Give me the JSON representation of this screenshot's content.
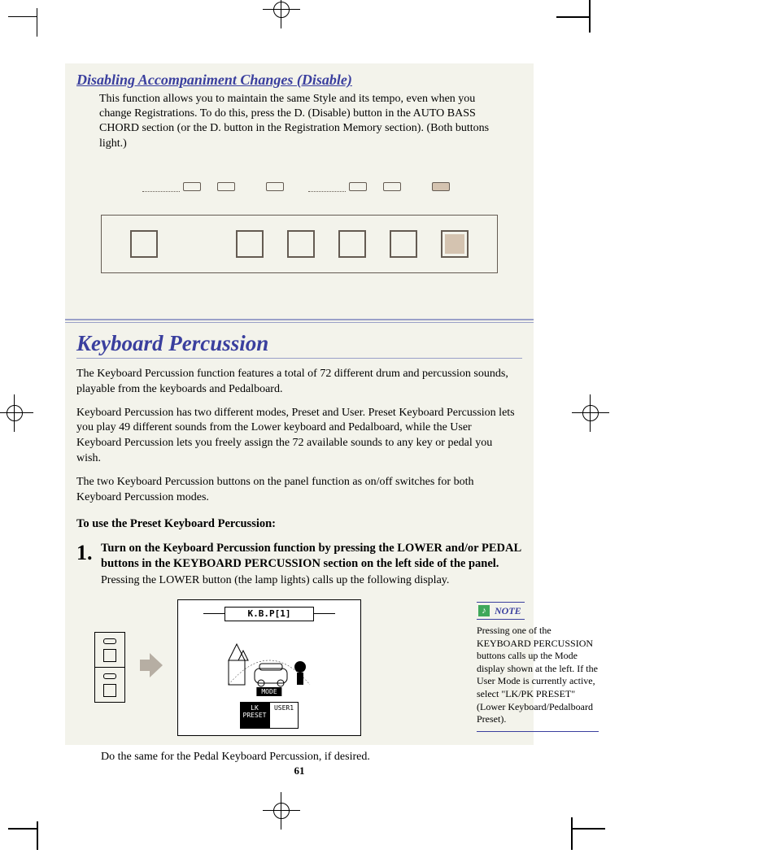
{
  "section1": {
    "title": "Disabling Accompaniment Changes (Disable)",
    "body": "This function allows you to maintain the same Style and its tempo, even when you change Registrations.  To do this, press the D. (Disable) button in the AUTO BASS CHORD section (or the D. button in the Registration Memory section).  (Both buttons light.)"
  },
  "section2": {
    "title": "Keyboard Percussion",
    "p1": "The Keyboard Percussion function features a total of 72 different drum and percussion sounds, playable from the keyboards and Pedalboard.",
    "p2": "Keyboard Percussion has two different modes, Preset and User. Preset Keyboard Percussion lets you play 49 different sounds from the Lower keyboard and Pedalboard, while the User Keyboard Percussion lets you freely assign the 72 available sounds to any key or pedal you wish.",
    "p3": "The two Keyboard Percussion buttons on the panel function as on/off switches for both Keyboard Percussion modes.",
    "howto": "To use the Preset Keyboard Percussion:",
    "step1_num": "1.",
    "step1_bold": "Turn on the Keyboard Percussion function by pressing the LOWER and/or PEDAL buttons in the KEYBOARD PERCUSSION section on the left side of the panel.",
    "step1_body": "Pressing the LOWER button (the lamp lights) calls up the following display.",
    "lcd": {
      "tab": "K.B.P[1]",
      "mode": "MODE",
      "opt1": "LK\nPRESET",
      "opt2": "USER1"
    },
    "followup": "Do the same for the Pedal Keyboard Percussion, if desired."
  },
  "note": {
    "label": "NOTE",
    "text": "Pressing one of the KEYBOARD PERCUSSION buttons calls up the Mode display shown at the left.  If the User Mode is currently active, select \"LK/PK PRESET\" (Lower Keyboard/Pedalboard Preset)."
  },
  "page_number": "61"
}
